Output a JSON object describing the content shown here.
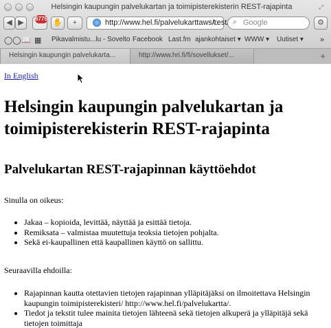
{
  "window": {
    "title": "Helsingin kaupungin palvelukartan ja toimipisterekisterin REST-rajapinta"
  },
  "toolbar": {
    "badge_count": "6775",
    "url": "http://www.hel.fi/palvelukarttaws/rest/",
    "search_placeholder": "Google"
  },
  "bookmarks": [
    "Pikavalmistu...lu - Sovelto",
    "Facebook",
    "Last.fm",
    "ajankohtaiset ▾",
    "WWW ▾",
    "Uutiset ▾"
  ],
  "tabs": [
    "Helsingin kaupungin palvelukarta...",
    "http://www.hri.fi/fi/sovellukset/..."
  ],
  "page": {
    "english_link": "In English",
    "heading": "Helsingin kaupungin palvelukartan ja toimipisterekisterin REST-rajapinta",
    "subheading": "Palvelukartan REST-rajapinnan käyttöehdot",
    "rights_intro": "Sinulla on oikeus:",
    "rights": [
      "Jakaa – kopioida, levittää, näyttää ja esittää tietoja.",
      "Remiksata – valmistaa muutettuja teoksia tietojen pohjalta.",
      "Sekä ei-kaupallinen että kaupallinen käyttö on sallittu."
    ],
    "conditions_intro": "Seuraavilla ehdoilla:",
    "conditions": [
      "Rajapinnan kautta otettavien tietojen rajapinnan ylläpitäjäksi on ilmoitettava Helsingin kaupungin toimipisterekisteri/ http://www.hel.fi/palvelukartta/.",
      "Tiedot ja tekstit tulee mainita tietojen lähteenä sekä tietojen alkuperä ja ylläpitäjä sekä tietojen toimittaja"
    ]
  }
}
